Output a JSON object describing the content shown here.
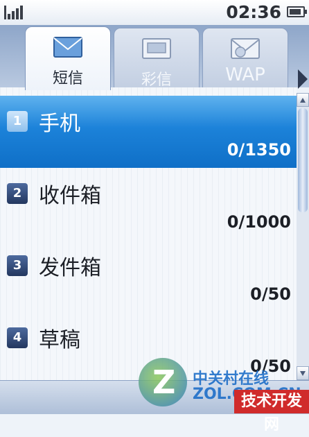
{
  "status": {
    "time": "02:36",
    "signal_icon": "signal-icon",
    "battery_icon": "battery-icon"
  },
  "tabs": [
    {
      "label": "短信",
      "icon": "envelope-icon",
      "active": true
    },
    {
      "label": "彩信",
      "icon": "picture-message-icon",
      "active": false
    },
    {
      "label": "WAP",
      "icon": "wap-envelope-icon",
      "active": false
    }
  ],
  "folders": [
    {
      "index": "1",
      "name": "手机",
      "count": "0/1350",
      "selected": true
    },
    {
      "index": "2",
      "name": "收件箱",
      "count": "0/1000",
      "selected": false
    },
    {
      "index": "3",
      "name": "发件箱",
      "count": "0/50",
      "selected": false
    },
    {
      "index": "4",
      "name": "草稿",
      "count": "0/50",
      "selected": false
    }
  ],
  "watermark": {
    "brand_cn": "中关村在线",
    "brand_en": "ZOL.COM.CN",
    "tag": "技术开发网"
  },
  "colors": {
    "selection": "#1c82d9",
    "tab_strip": "#8ea6c9",
    "badge": "#23375f"
  }
}
